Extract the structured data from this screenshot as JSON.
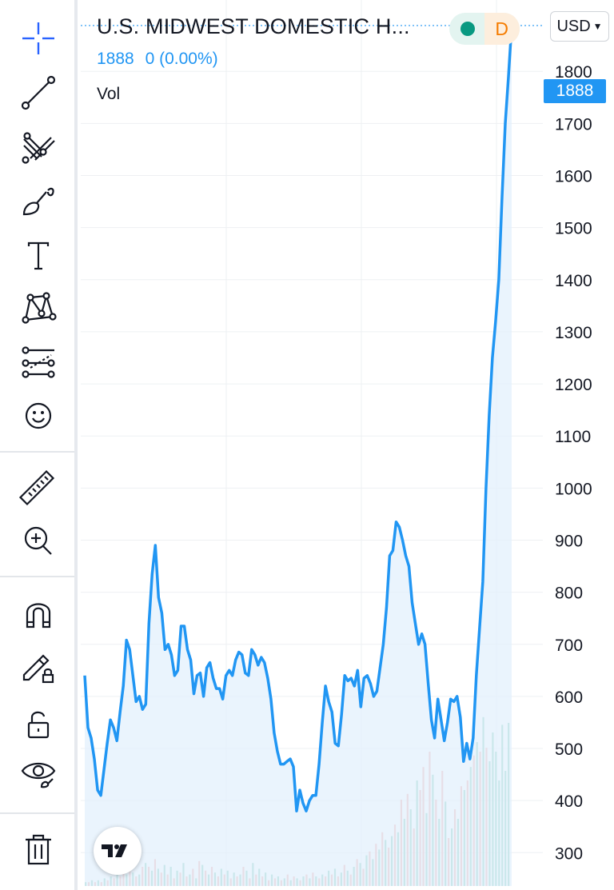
{
  "header": {
    "title": "U.S. MIDWEST DOMESTIC H...",
    "last_price": "1888",
    "change": "0 (0.00%)",
    "volume_label": "Vol",
    "status_letter": "D",
    "currency": "USD",
    "price_tag": "1888"
  },
  "toolbar": {
    "items": [
      "crosshair-icon",
      "trend-line-icon",
      "fib-pitchfork-icon",
      "brush-icon",
      "text-icon",
      "pattern-icon",
      "forecast-icon",
      "emoji-icon",
      "ruler-icon",
      "zoom-in-icon",
      "magnet-icon",
      "lock-drawings-icon",
      "unlock-icon",
      "eye-icon",
      "trash-icon"
    ]
  },
  "colors": {
    "line": "#2196f3",
    "area": "#e3f0fc",
    "vol_up": "#7fcbb8",
    "vol_down": "#f4a7a3",
    "grid": "#eef0f3",
    "axis_text": "#131722"
  },
  "chart_data": {
    "type": "line",
    "y_axis": {
      "ticks": [
        300,
        400,
        500,
        600,
        700,
        800,
        900,
        1000,
        1100,
        1200,
        1300,
        1400,
        1500,
        1600,
        1700,
        1800
      ],
      "ylim": [
        236,
        1937
      ]
    },
    "last_value": 1888,
    "price": [
      640,
      540,
      520,
      480,
      420,
      410,
      460,
      510,
      555,
      540,
      515,
      570,
      620,
      708,
      690,
      640,
      590,
      600,
      575,
      585,
      740,
      835,
      890,
      790,
      760,
      690,
      700,
      680,
      640,
      650,
      735,
      735,
      690,
      670,
      605,
      640,
      645,
      600,
      655,
      665,
      635,
      615,
      615,
      595,
      640,
      650,
      640,
      670,
      685,
      680,
      645,
      640,
      690,
      680,
      660,
      675,
      665,
      635,
      595,
      530,
      495,
      470,
      470,
      475,
      480,
      465,
      380,
      420,
      395,
      380,
      400,
      410,
      410,
      470,
      550,
      620,
      590,
      570,
      510,
      505,
      565,
      640,
      630,
      635,
      620,
      650,
      580,
      635,
      640,
      625,
      600,
      610,
      655,
      700,
      770,
      870,
      880,
      935,
      925,
      900,
      870,
      850,
      780,
      740,
      700,
      720,
      700,
      625,
      555,
      520,
      595,
      555,
      515,
      550,
      595,
      590,
      600,
      560,
      475,
      510,
      480,
      520,
      640,
      730,
      820,
      1000,
      1140,
      1250,
      1320,
      1400,
      1560,
      1700,
      1790,
      1888
    ],
    "volume_bars": [
      {
        "v": 2,
        "c": "up"
      },
      {
        "v": 2,
        "c": "down"
      },
      {
        "v": 3,
        "c": "up"
      },
      {
        "v": 2,
        "c": "down"
      },
      {
        "v": 3,
        "c": "up"
      },
      {
        "v": 2,
        "c": "down"
      },
      {
        "v": 4,
        "c": "up"
      },
      {
        "v": 3,
        "c": "down"
      },
      {
        "v": 5,
        "c": "up"
      },
      {
        "v": 4,
        "c": "down"
      },
      {
        "v": 6,
        "c": "up"
      },
      {
        "v": 5,
        "c": "down"
      },
      {
        "v": 26,
        "c": "down"
      },
      {
        "v": 6,
        "c": "up"
      },
      {
        "v": 8,
        "c": "down"
      },
      {
        "v": 7,
        "c": "up"
      },
      {
        "v": 5,
        "c": "down"
      },
      {
        "v": 6,
        "c": "up"
      },
      {
        "v": 10,
        "c": "down"
      },
      {
        "v": 12,
        "c": "up"
      },
      {
        "v": 10,
        "c": "down"
      },
      {
        "v": 8,
        "c": "up"
      },
      {
        "v": 14,
        "c": "down"
      },
      {
        "v": 9,
        "c": "up"
      },
      {
        "v": 7,
        "c": "down"
      },
      {
        "v": 11,
        "c": "up"
      },
      {
        "v": 6,
        "c": "down"
      },
      {
        "v": 10,
        "c": "up"
      },
      {
        "v": 4,
        "c": "down"
      },
      {
        "v": 8,
        "c": "up"
      },
      {
        "v": 7,
        "c": "down"
      },
      {
        "v": 12,
        "c": "up"
      },
      {
        "v": 5,
        "c": "down"
      },
      {
        "v": 6,
        "c": "up"
      },
      {
        "v": 9,
        "c": "down"
      },
      {
        "v": 4,
        "c": "up"
      },
      {
        "v": 13,
        "c": "down"
      },
      {
        "v": 11,
        "c": "up"
      },
      {
        "v": 8,
        "c": "down"
      },
      {
        "v": 6,
        "c": "up"
      },
      {
        "v": 10,
        "c": "down"
      },
      {
        "v": 7,
        "c": "up"
      },
      {
        "v": 5,
        "c": "down"
      },
      {
        "v": 9,
        "c": "up"
      },
      {
        "v": 6,
        "c": "down"
      },
      {
        "v": 8,
        "c": "up"
      },
      {
        "v": 4,
        "c": "down"
      },
      {
        "v": 7,
        "c": "up"
      },
      {
        "v": 5,
        "c": "down"
      },
      {
        "v": 6,
        "c": "up"
      },
      {
        "v": 10,
        "c": "down"
      },
      {
        "v": 8,
        "c": "up"
      },
      {
        "v": 4,
        "c": "down"
      },
      {
        "v": 12,
        "c": "up"
      },
      {
        "v": 6,
        "c": "down"
      },
      {
        "v": 9,
        "c": "up"
      },
      {
        "v": 5,
        "c": "down"
      },
      {
        "v": 7,
        "c": "up"
      },
      {
        "v": 3,
        "c": "down"
      },
      {
        "v": 6,
        "c": "up"
      },
      {
        "v": 4,
        "c": "down"
      },
      {
        "v": 5,
        "c": "up"
      },
      {
        "v": 3,
        "c": "down"
      },
      {
        "v": 4,
        "c": "up"
      },
      {
        "v": 6,
        "c": "down"
      },
      {
        "v": 3,
        "c": "up"
      },
      {
        "v": 5,
        "c": "down"
      },
      {
        "v": 4,
        "c": "up"
      },
      {
        "v": 3,
        "c": "down"
      },
      {
        "v": 5,
        "c": "up"
      },
      {
        "v": 6,
        "c": "down"
      },
      {
        "v": 4,
        "c": "up"
      },
      {
        "v": 7,
        "c": "down"
      },
      {
        "v": 5,
        "c": "up"
      },
      {
        "v": 4,
        "c": "down"
      },
      {
        "v": 6,
        "c": "up"
      },
      {
        "v": 5,
        "c": "down"
      },
      {
        "v": 8,
        "c": "up"
      },
      {
        "v": 6,
        "c": "down"
      },
      {
        "v": 9,
        "c": "up"
      },
      {
        "v": 5,
        "c": "down"
      },
      {
        "v": 7,
        "c": "up"
      },
      {
        "v": 11,
        "c": "down"
      },
      {
        "v": 8,
        "c": "up"
      },
      {
        "v": 6,
        "c": "down"
      },
      {
        "v": 10,
        "c": "up"
      },
      {
        "v": 14,
        "c": "down"
      },
      {
        "v": 12,
        "c": "up"
      },
      {
        "v": 9,
        "c": "down"
      },
      {
        "v": 16,
        "c": "up"
      },
      {
        "v": 18,
        "c": "down"
      },
      {
        "v": 14,
        "c": "up"
      },
      {
        "v": 22,
        "c": "down"
      },
      {
        "v": 19,
        "c": "up"
      },
      {
        "v": 28,
        "c": "down"
      },
      {
        "v": 24,
        "c": "up"
      },
      {
        "v": 20,
        "c": "down"
      },
      {
        "v": 26,
        "c": "up"
      },
      {
        "v": 32,
        "c": "down"
      },
      {
        "v": 28,
        "c": "up"
      },
      {
        "v": 45,
        "c": "down"
      },
      {
        "v": 35,
        "c": "up"
      },
      {
        "v": 48,
        "c": "down"
      },
      {
        "v": 40,
        "c": "up"
      },
      {
        "v": 30,
        "c": "down"
      },
      {
        "v": 55,
        "c": "up"
      },
      {
        "v": 50,
        "c": "down"
      },
      {
        "v": 62,
        "c": "down"
      },
      {
        "v": 38,
        "c": "up"
      },
      {
        "v": 70,
        "c": "down"
      },
      {
        "v": 58,
        "c": "up"
      },
      {
        "v": 45,
        "c": "down"
      },
      {
        "v": 35,
        "c": "up"
      },
      {
        "v": 60,
        "c": "down"
      },
      {
        "v": 44,
        "c": "up"
      },
      {
        "v": 25,
        "c": "down"
      },
      {
        "v": 30,
        "c": "up"
      },
      {
        "v": 40,
        "c": "down"
      },
      {
        "v": 35,
        "c": "up"
      },
      {
        "v": 52,
        "c": "down"
      },
      {
        "v": 50,
        "c": "up"
      },
      {
        "v": 55,
        "c": "down"
      },
      {
        "v": 62,
        "c": "up"
      },
      {
        "v": 68,
        "c": "down"
      },
      {
        "v": 75,
        "c": "up"
      },
      {
        "v": 70,
        "c": "down"
      },
      {
        "v": 88,
        "c": "up"
      },
      {
        "v": 72,
        "c": "down"
      },
      {
        "v": 65,
        "c": "up"
      },
      {
        "v": 80,
        "c": "up"
      },
      {
        "v": 70,
        "c": "up"
      },
      {
        "v": 55,
        "c": "up"
      },
      {
        "v": 84,
        "c": "up"
      },
      {
        "v": 60,
        "c": "up"
      },
      {
        "v": 85,
        "c": "up"
      }
    ],
    "grid": true
  }
}
